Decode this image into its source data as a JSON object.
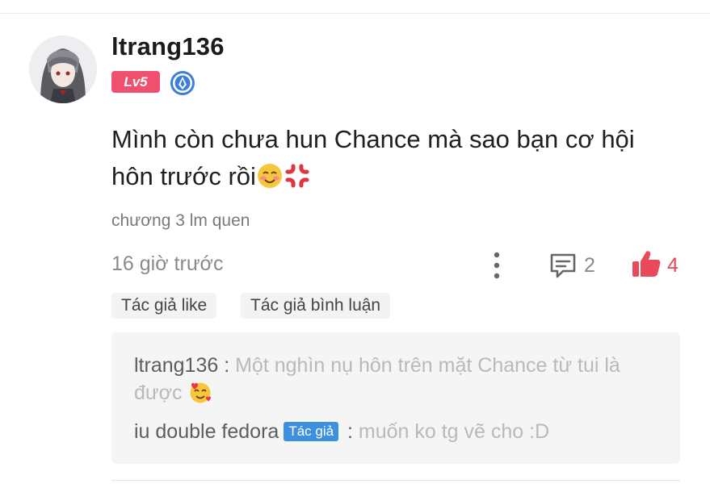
{
  "comment": {
    "username": "ltrang136",
    "level_badge": "Lv5",
    "content_line1": "Mình còn chưa hun Chance mà sao bạn cơ hội",
    "content_line2": "hôn trước rồi",
    "chapter": "chương 3 lm quen",
    "time": "16 giờ trước",
    "reply_count": "2",
    "like_count": "4"
  },
  "chips": {
    "author_like": "Tác giả like",
    "author_reply": "Tác giả bình luận"
  },
  "replies": [
    {
      "name": "ltrang136",
      "separator": " : ",
      "text": "Một nghìn nụ hôn trên mặt Chance từ tui là được"
    },
    {
      "name": "iu double fedora",
      "tag": "Tác giả",
      "separator": " : ",
      "text": "muốn ko tg vẽ cho :D"
    }
  ],
  "colors": {
    "level_badge": "#f0506e",
    "like_accent": "#e84a5a",
    "author_tag": "#3d8fe0",
    "verified_badge": "#3c7fd8"
  },
  "icons": {
    "more": "vertical-dots-icon",
    "comment": "comment-icon",
    "like": "thumbs-up-icon"
  }
}
